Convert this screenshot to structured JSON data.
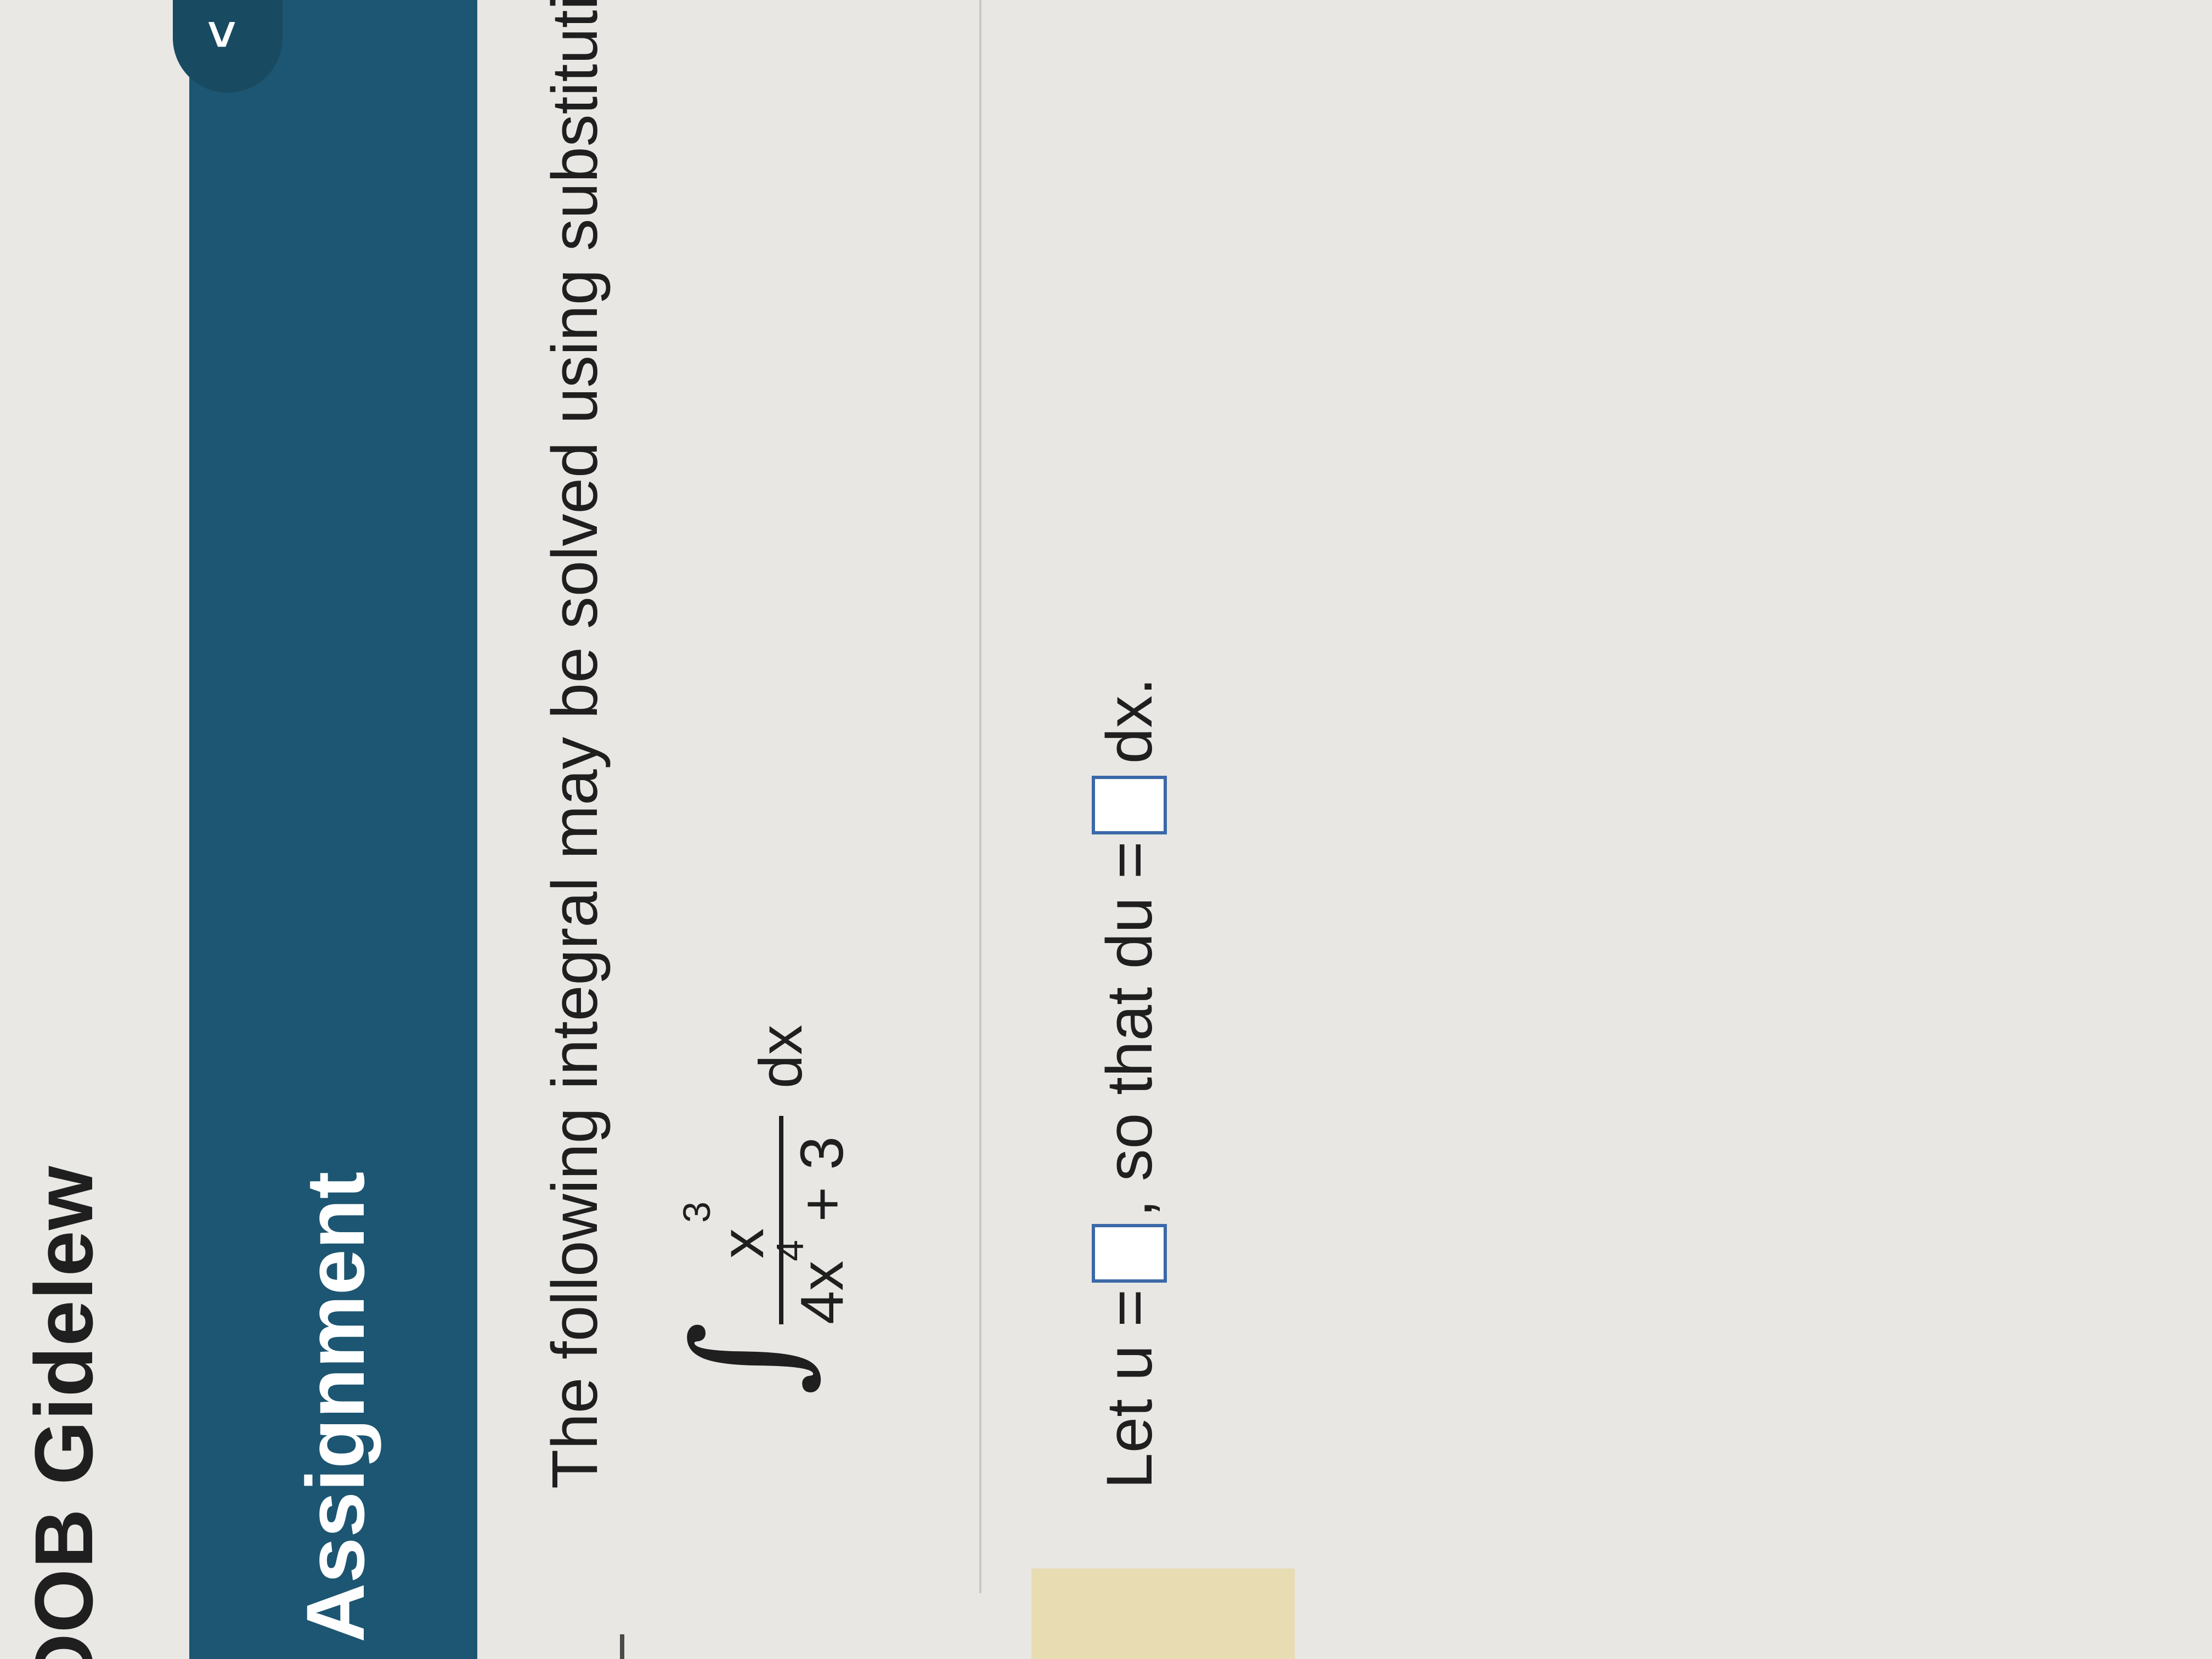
{
  "course": {
    "title": "OOB Gidelew"
  },
  "banner": {
    "title": "Assignment",
    "collapse_glyph": "<"
  },
  "question": {
    "prompt": "The following integral may be solved using substitution. Cho",
    "integral": {
      "sign": "∫",
      "numerator_base": "x",
      "numerator_exp": "3",
      "denominator_base": "4x",
      "denominator_exp": "4",
      "denominator_tail": " + 3",
      "differential": "dx"
    },
    "answer": {
      "let_u": "Let u =",
      "so_that": ", so that du =",
      "dx_suffix": "dx.",
      "u_value": "",
      "du_value": ""
    }
  },
  "colors": {
    "banner": "#1c5672",
    "input_border": "#3b68a8",
    "accent": "#e7dcb2"
  }
}
